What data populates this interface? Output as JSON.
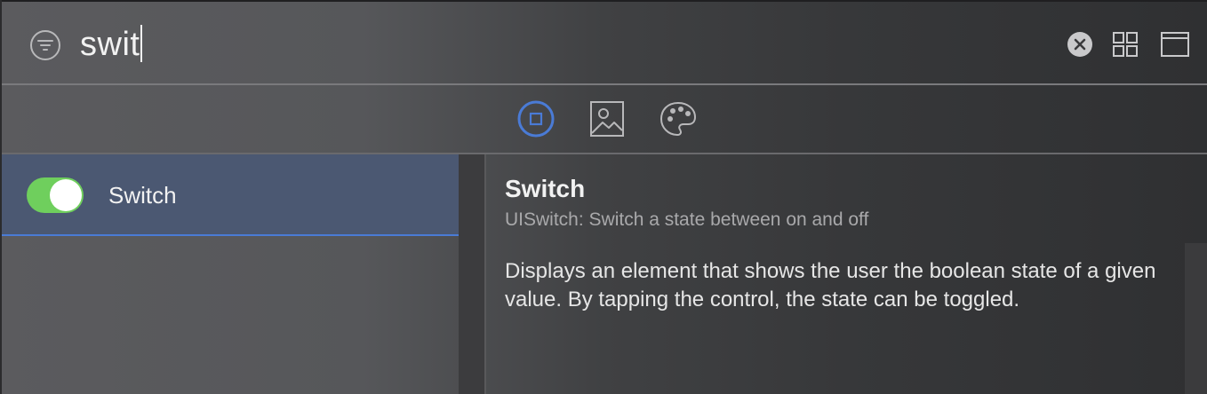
{
  "search": {
    "query": "swit"
  },
  "header_icons": [
    "filter-icon",
    "clear-search-icon",
    "grid-view-icon",
    "window-icon"
  ],
  "segments": [
    {
      "name": "objects",
      "icon": "object-square-icon",
      "selected": true
    },
    {
      "name": "media",
      "icon": "image-icon",
      "selected": false
    },
    {
      "name": "colors",
      "icon": "palette-icon",
      "selected": false
    }
  ],
  "library": {
    "items": [
      {
        "label": "Switch",
        "selected": true,
        "icon": "switch-toggle-icon"
      }
    ]
  },
  "detail": {
    "title": "Switch",
    "subtitle": "UISwitch: Switch a state between on and off",
    "description": "Displays an element that shows the user the boolean state of a given value.  By tapping the control, the state can be toggled."
  },
  "colors": {
    "accent": "#4a7bd6",
    "toggle_on": "#6fcf5d",
    "selection": "#4b5872"
  }
}
